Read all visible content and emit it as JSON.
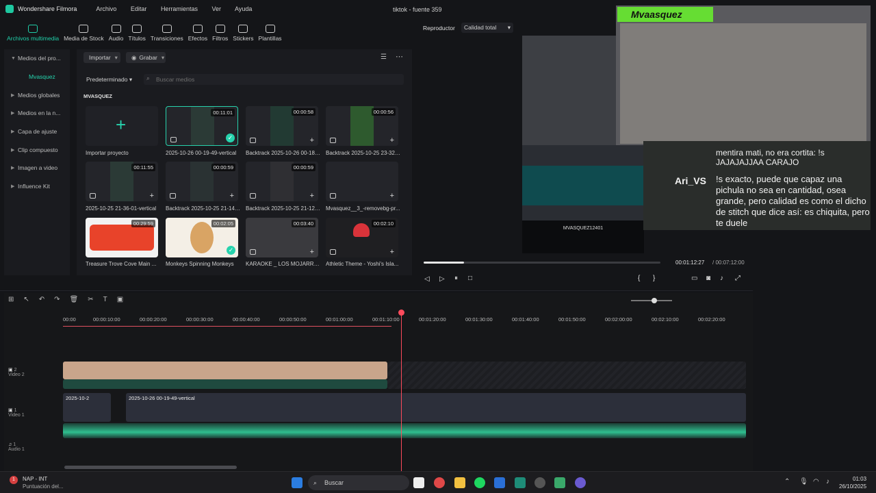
{
  "titlebar": {
    "app_name": "Wondershare Filmora",
    "menu": [
      "Archivo",
      "Editar",
      "Herramientas",
      "Ver",
      "Ayuda"
    ],
    "doc_title": "tiktok - fuente 359"
  },
  "tooltabs": [
    "Archivos multimedia",
    "Media de Stock",
    "Audio",
    "Títulos",
    "Transiciones",
    "Efectos",
    "Filtros",
    "Stickers",
    "Plantillas"
  ],
  "leftnav": {
    "items": [
      "Medios del pro...",
      "Mvasquez",
      "Medios globales",
      "Medios en la n...",
      "Capa de ajuste",
      "Clip compuesto",
      "Imagen a video",
      "Influence Kit"
    ]
  },
  "media": {
    "import_label": "Importar",
    "record_label": "Grabar",
    "sort_label": "Predeterminado",
    "search_placeholder": "Buscar medios",
    "folder": "MVASQUEZ",
    "items": [
      {
        "caption": "Importar proyecto",
        "duration": ""
      },
      {
        "caption": "2025-10-26 00-19-49-vertical",
        "duration": "00:11:01"
      },
      {
        "caption": "Backtrack 2025-10-26 00-18-...",
        "duration": "00:00:58"
      },
      {
        "caption": "Backtrack 2025-10-25 23-32-...",
        "duration": "00:00:56"
      },
      {
        "caption": "2025-10-25 21-36-01-vertical",
        "duration": "00:11:55"
      },
      {
        "caption": "Backtrack 2025-10-25 21-14-...",
        "duration": "00:00:59"
      },
      {
        "caption": "Backtrack 2025-10-25 21-12-...",
        "duration": "00:00:59"
      },
      {
        "caption": "Mvasquez__3_-removebg-pr...",
        "duration": ""
      },
      {
        "caption": "Treasure Trove Cove   Main ...",
        "duration": "00:29:59"
      },
      {
        "caption": "Monkeys Spinning Monkeys",
        "duration": "00:02:05"
      },
      {
        "caption": "KARAOKE _ LOS MOJARRA...",
        "duration": "00:03:40"
      },
      {
        "caption": "Athletic Theme - Yoshi's Isla...",
        "duration": "00:02:10"
      }
    ]
  },
  "player": {
    "label": "Reproductor",
    "quality": "Calidad total",
    "current_time": "00:01:12:27",
    "total_time": "/ 00:07:12:00",
    "progress": 0.17
  },
  "overlay": {
    "streamer": "Mvaasquez",
    "chat_user": "Ari_VS",
    "msg1": "mentira mati, no era cortita: !s JAJAJAJJAA CARAJO",
    "msg2": "!s exacto, puede que capaz una pichula no sea en cantidad, osea grande, pero calidad es como el dicho de stitch que dice así: es chiquita, pero te duele",
    "video_text": "MVASQUEZ12401"
  },
  "timeline": {
    "ruler": [
      "00:00",
      "00:00:10:00",
      "00:00:20:00",
      "00:00:30:00",
      "00:00:40:00",
      "00:00:50:00",
      "00:01:00:00",
      "00:01:10:00",
      "00:01:20:00",
      "00:01:30:00",
      "00:01:40:00",
      "00:01:50:00",
      "00:02:00:00",
      "00:02:10:00",
      "00:02:20:00"
    ],
    "tracks": [
      {
        "num": "2",
        "name": "Video 2"
      },
      {
        "num": "1",
        "name": "Video 1"
      },
      {
        "num": "1",
        "name": "Audio 1"
      }
    ],
    "clip_label": "2025-10-26 00-19-49-vertical",
    "clip_label_short": "2025-10-2"
  },
  "taskbar": {
    "weather_title": "NAP - INT",
    "weather_sub": "Puntuación del...",
    "search": "Buscar",
    "time": "01:03",
    "date": "26/10/2025"
  }
}
